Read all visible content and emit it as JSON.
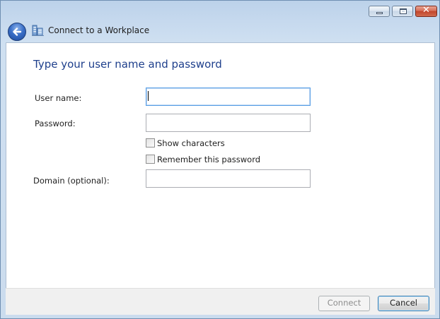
{
  "window": {
    "title": "Connect to a Workplace"
  },
  "caption_buttons": {
    "minimize": "minimize-icon",
    "maximize": "maximize-icon",
    "close": "close-icon",
    "close_glyph": "✕"
  },
  "navigation": {
    "back_icon": "back-arrow-icon"
  },
  "content": {
    "heading": "Type your user name and password",
    "fields": {
      "username_label": "User name:",
      "username_value": "",
      "password_label": "Password:",
      "password_value": "",
      "domain_label": "Domain (optional):",
      "domain_value": ""
    },
    "checkboxes": {
      "show_characters": "Show characters",
      "show_characters_checked": false,
      "remember_password": "Remember this password",
      "remember_password_checked": false
    }
  },
  "footer": {
    "connect_label": "Connect",
    "connect_enabled": false,
    "cancel_label": "Cancel"
  },
  "colors": {
    "heading": "#1e3f8c",
    "window_frame": "#c6d9ee",
    "close_button": "#c2442a",
    "focus_border": "#569de5"
  }
}
